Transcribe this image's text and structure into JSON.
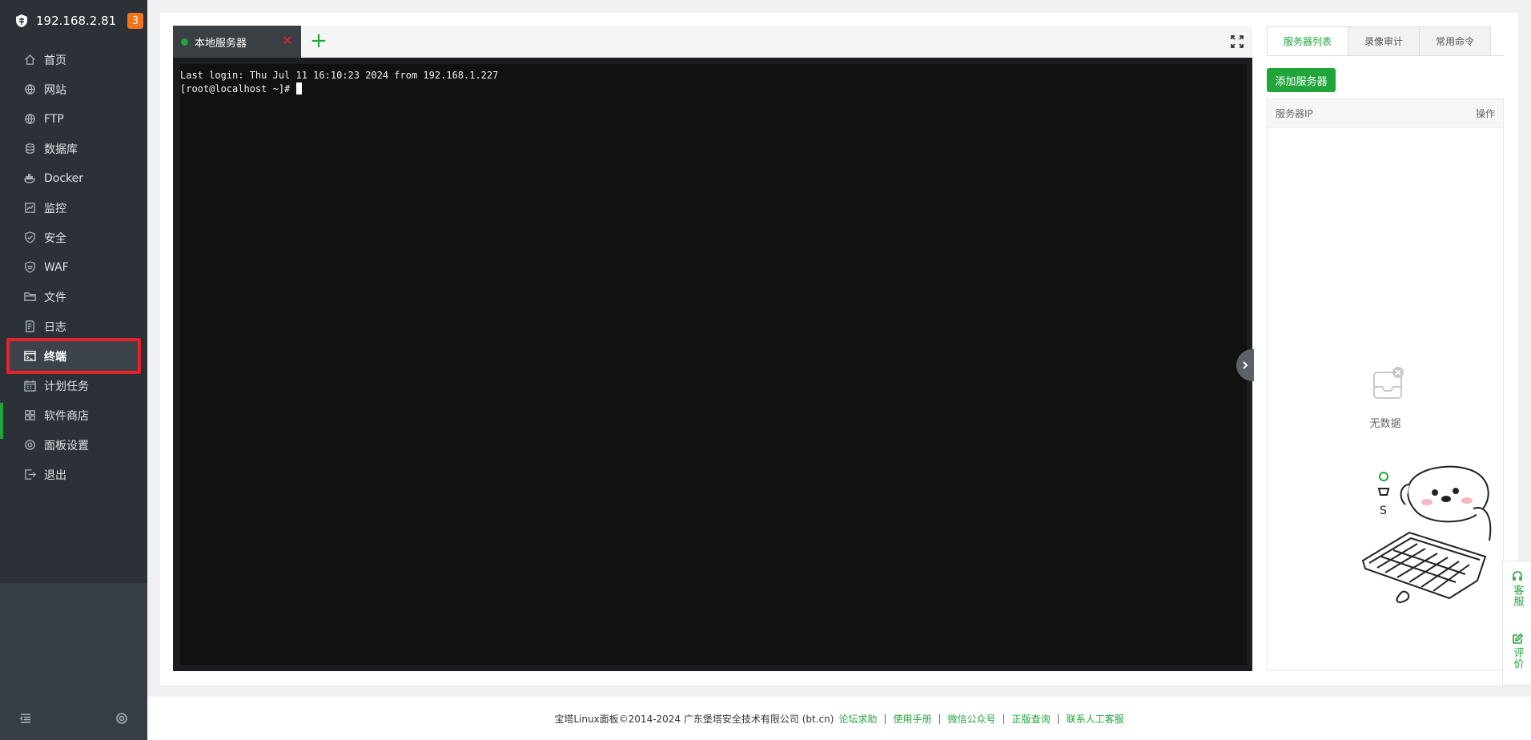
{
  "sidebar": {
    "server_ip": "192.168.2.81",
    "badge_count": "3",
    "items": [
      {
        "label": "首页",
        "icon": "home-icon"
      },
      {
        "label": "网站",
        "icon": "globe-icon"
      },
      {
        "label": "FTP",
        "icon": "globe-icon"
      },
      {
        "label": "数据库",
        "icon": "database-icon"
      },
      {
        "label": "Docker",
        "icon": "docker-icon"
      },
      {
        "label": "监控",
        "icon": "chart-icon"
      },
      {
        "label": "安全",
        "icon": "shield-icon"
      },
      {
        "label": "WAF",
        "icon": "waf-icon"
      },
      {
        "label": "文件",
        "icon": "folder-icon"
      },
      {
        "label": "日志",
        "icon": "log-icon"
      },
      {
        "label": "终端",
        "icon": "terminal-icon"
      },
      {
        "label": "计划任务",
        "icon": "calendar-icon"
      },
      {
        "label": "软件商店",
        "icon": "apps-icon"
      },
      {
        "label": "面板设置",
        "icon": "gear-icon"
      },
      {
        "label": "退出",
        "icon": "logout-icon"
      }
    ],
    "active_item": "终端"
  },
  "terminal": {
    "tab_label": "本地服务器",
    "lines": [
      "Last login: Thu Jul 11 16:10:23 2024 from 192.168.1.227",
      "[root@localhost ~]# "
    ]
  },
  "right_panel": {
    "tabs": [
      "服务器列表",
      "录像审计",
      "常用命令"
    ],
    "active_tab": "服务器列表",
    "add_server_label": "添加服务器",
    "table_headers": {
      "ip": "服务器IP",
      "action": "操作"
    },
    "empty_text": "无数据"
  },
  "support": {
    "service_label": "客服",
    "review_label": "评价"
  },
  "footer": {
    "copyright": "宝塔Linux面板©2014-2024 广东堡塔安全技术有限公司 (bt.cn)",
    "links": [
      "论坛求助",
      "使用手册",
      "微信公众号",
      "正版查询",
      "联系人工客服"
    ]
  },
  "colors": {
    "accent": "#20a53a",
    "highlight_border": "#e8202a",
    "badge": "#f0741b",
    "sidebar_bg": "#2b3137"
  }
}
